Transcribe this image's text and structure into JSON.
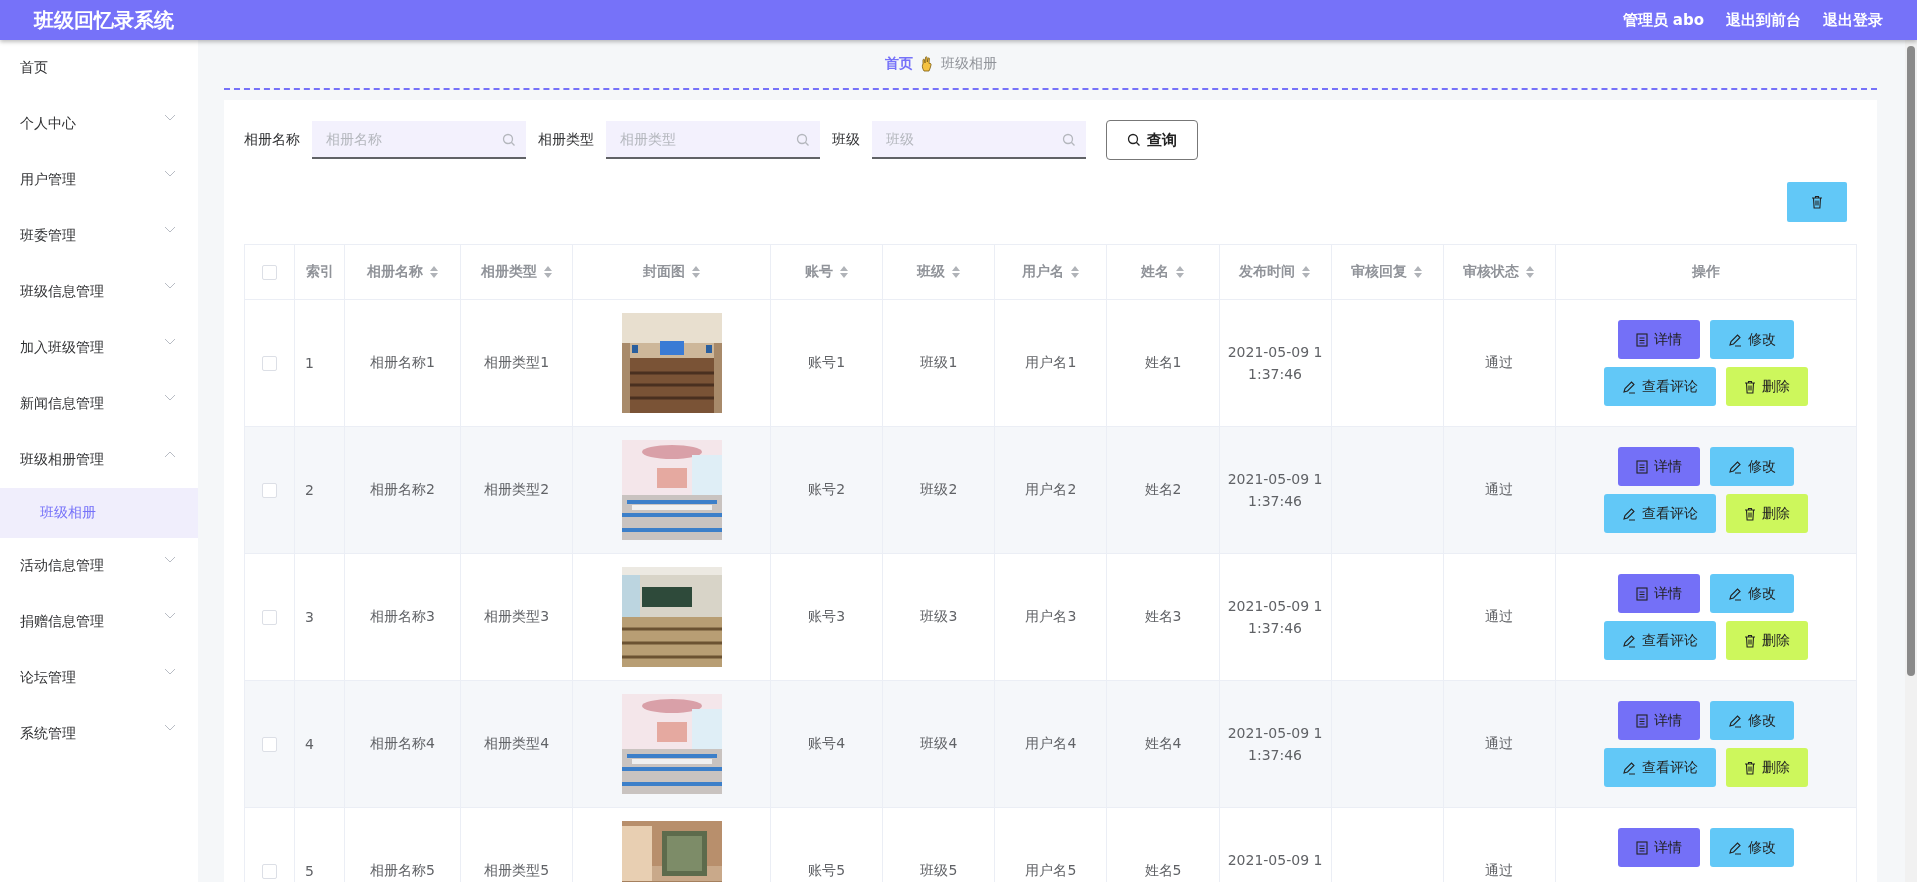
{
  "header": {
    "title": "班级回忆录系统",
    "links": [
      "管理员 abo",
      "退出到前台",
      "退出登录"
    ]
  },
  "sidebar": {
    "items": [
      {
        "label": "首页",
        "kind": "link"
      },
      {
        "label": "个人中心",
        "kind": "group",
        "expanded": false
      },
      {
        "label": "用户管理",
        "kind": "group",
        "expanded": false
      },
      {
        "label": "班委管理",
        "kind": "group",
        "expanded": false
      },
      {
        "label": "班级信息管理",
        "kind": "group",
        "expanded": false
      },
      {
        "label": "加入班级管理",
        "kind": "group",
        "expanded": false
      },
      {
        "label": "新闻信息管理",
        "kind": "group",
        "expanded": false
      },
      {
        "label": "班级相册管理",
        "kind": "group",
        "expanded": true,
        "children": [
          {
            "label": "班级相册",
            "selected": true
          }
        ]
      },
      {
        "label": "活动信息管理",
        "kind": "group",
        "expanded": false
      },
      {
        "label": "捐赠信息管理",
        "kind": "group",
        "expanded": false
      },
      {
        "label": "论坛管理",
        "kind": "group",
        "expanded": false
      },
      {
        "label": "系统管理",
        "kind": "group",
        "expanded": false
      }
    ]
  },
  "breadcrumb": [
    "首页",
    "班级相册"
  ],
  "search": {
    "fields": [
      {
        "label": "相册名称",
        "placeholder": "相册名称"
      },
      {
        "label": "相册类型",
        "placeholder": "相册类型"
      },
      {
        "label": "班级",
        "placeholder": "班级"
      }
    ],
    "button": "查询"
  },
  "table": {
    "select_all": {
      "checked": false
    },
    "columns": [
      {
        "label": "索引",
        "sortable": false
      },
      {
        "label": "相册名称",
        "sortable": true
      },
      {
        "label": "相册类型",
        "sortable": true
      },
      {
        "label": "封面图",
        "sortable": true
      },
      {
        "label": "账号",
        "sortable": true
      },
      {
        "label": "班级",
        "sortable": true
      },
      {
        "label": "用户名",
        "sortable": true
      },
      {
        "label": "姓名",
        "sortable": true
      },
      {
        "label": "发布时间",
        "sortable": true
      },
      {
        "label": "审核回复",
        "sortable": true
      },
      {
        "label": "审核状态",
        "sortable": true
      },
      {
        "label": "操作",
        "sortable": false
      }
    ],
    "rows": [
      {
        "checked": false,
        "index": "1",
        "name": "相册名称1",
        "type": "相册类型1",
        "account": "账号1",
        "class": "班级1",
        "username": "用户名1",
        "realname": "姓名1",
        "time": [
          "2021-05-09 1",
          "1:37:46"
        ],
        "status": "通过",
        "actions": [
          [
            {
              "label": "详情",
              "kind": "detail"
            },
            {
              "label": "修改",
              "kind": "edit"
            }
          ],
          [
            {
              "label": "查看评论",
              "kind": "comments"
            },
            {
              "label": "删除",
              "kind": "delete"
            }
          ]
        ]
      },
      {
        "checked": false,
        "index": "2",
        "name": "相册名称2",
        "type": "相册类型2",
        "account": "账号2",
        "class": "班级2",
        "username": "用户名2",
        "realname": "姓名2",
        "time": [
          "2021-05-09 1",
          "1:37:46"
        ],
        "status": "通过",
        "actions": [
          [
            {
              "label": "详情",
              "kind": "detail"
            },
            {
              "label": "修改",
              "kind": "edit"
            }
          ],
          [
            {
              "label": "查看评论",
              "kind": "comments"
            },
            {
              "label": "删除",
              "kind": "delete"
            }
          ]
        ]
      },
      {
        "checked": false,
        "index": "3",
        "name": "相册名称3",
        "type": "相册类型3",
        "account": "账号3",
        "class": "班级3",
        "username": "用户名3",
        "realname": "姓名3",
        "time": [
          "2021-05-09 1",
          "1:37:46"
        ],
        "status": "通过",
        "actions": [
          [
            {
              "label": "详情",
              "kind": "detail"
            },
            {
              "label": "修改",
              "kind": "edit"
            }
          ],
          [
            {
              "label": "查看评论",
              "kind": "comments"
            },
            {
              "label": "删除",
              "kind": "delete"
            }
          ]
        ]
      },
      {
        "checked": false,
        "index": "4",
        "name": "相册名称4",
        "type": "相册类型4",
        "account": "账号4",
        "class": "班级4",
        "username": "用户名4",
        "realname": "姓名4",
        "time": [
          "2021-05-09 1",
          "1:37:46"
        ],
        "status": "通过",
        "actions": [
          [
            {
              "label": "详情",
              "kind": "detail"
            },
            {
              "label": "修改",
              "kind": "edit"
            }
          ],
          [
            {
              "label": "查看评论",
              "kind": "comments"
            },
            {
              "label": "删除",
              "kind": "delete"
            }
          ]
        ]
      },
      {
        "checked": false,
        "index": "5",
        "name": "相册名称5",
        "type": "相册类型5",
        "account": "账号5",
        "class": "班级5",
        "username": "用户名5",
        "realname": "姓名5",
        "time": [
          "2021-05-09 1"
        ],
        "status": "通过",
        "actions": [
          [
            {
              "label": "详情",
              "kind": "detail"
            },
            {
              "label": "修改",
              "kind": "edit"
            }
          ]
        ]
      }
    ]
  }
}
